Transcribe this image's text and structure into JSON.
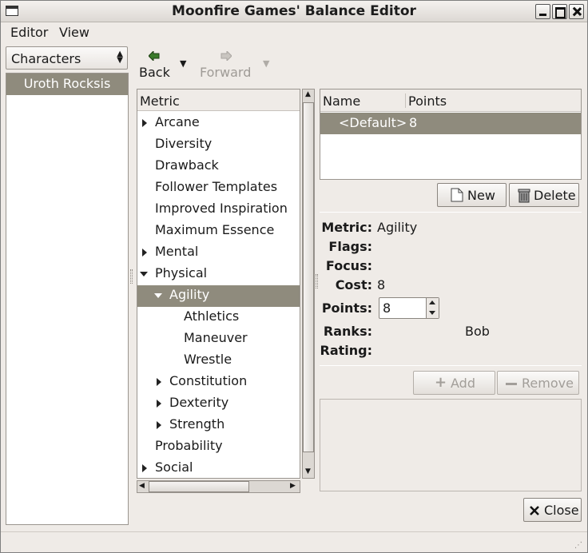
{
  "window": {
    "title": "Moonfire Games' Balance Editor"
  },
  "menu": {
    "editor": "Editor",
    "view": "View"
  },
  "left": {
    "combo_value": "Characters",
    "items": [
      "Uroth Rocksis"
    ]
  },
  "toolbar": {
    "back": "Back",
    "forward": "Forward"
  },
  "tree": {
    "header": "Metric",
    "rows": [
      {
        "label": "Arcane"
      },
      {
        "label": "Diversity"
      },
      {
        "label": "Drawback"
      },
      {
        "label": "Follower Templates"
      },
      {
        "label": "Improved Inspiration"
      },
      {
        "label": "Maximum Essence"
      },
      {
        "label": "Mental"
      },
      {
        "label": "Physical"
      },
      {
        "label": "Agility"
      },
      {
        "label": "Athletics"
      },
      {
        "label": "Maneuver"
      },
      {
        "label": "Wrestle"
      },
      {
        "label": "Constitution"
      },
      {
        "label": "Dexterity"
      },
      {
        "label": "Strength"
      },
      {
        "label": "Probability"
      },
      {
        "label": "Social"
      }
    ]
  },
  "points_list": {
    "col_name": "Name",
    "col_points": "Points",
    "rows": [
      {
        "name": "<Default>",
        "points": "8"
      }
    ]
  },
  "buttons": {
    "new": "New",
    "delete": "Delete",
    "add": "Add",
    "remove": "Remove",
    "close": "Close"
  },
  "details": {
    "metric_label": "Metric:",
    "metric_value": "Agility",
    "flags_label": "Flags:",
    "focus_label": "Focus:",
    "cost_label": "Cost:",
    "cost_value": "8",
    "points_label": "Points:",
    "points_value": "8",
    "ranks_label": "Ranks:",
    "ranks_value": "Bob",
    "rating_label": "Rating:"
  },
  "colors": {
    "selection": "#8f8b7d",
    "window_bg": "#efebe7"
  }
}
